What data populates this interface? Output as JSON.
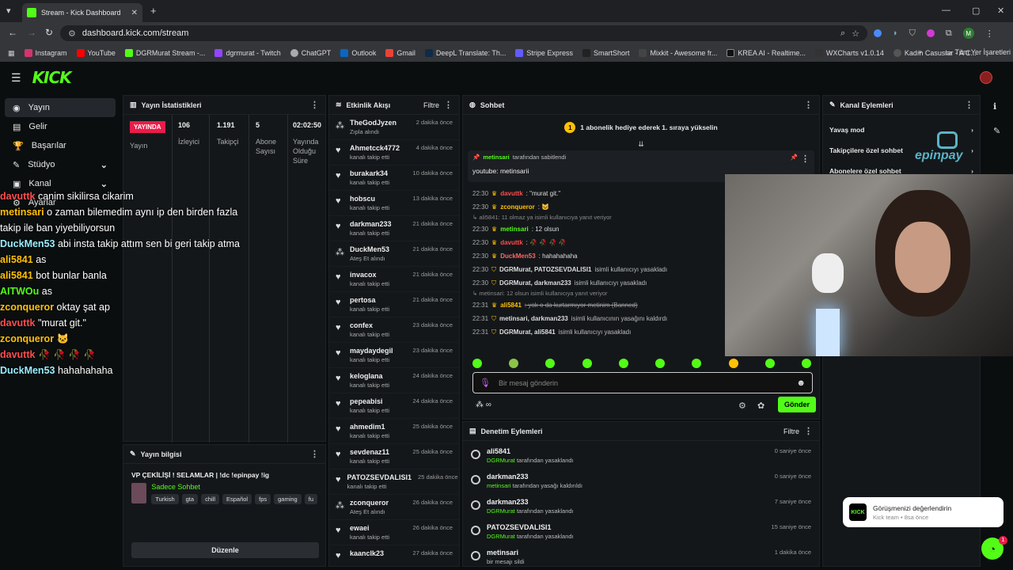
{
  "browser": {
    "tab_title": "Stream - Kick Dashboard",
    "url": "dashboard.kick.com/stream",
    "bookmarks": [
      "Instagram",
      "YouTube",
      "DGRMurat Stream -...",
      "dgrmurat - Twitch",
      "ChatGPT",
      "Outlook",
      "Gmail",
      "DeepL Translate: Th...",
      "Stripe Express",
      "SmartShort",
      "Mixkit - Awesome fr...",
      "KREA AI - Realtime...",
      "WXCharts v1.0.14",
      "Kadın Casuslar - A C..."
    ],
    "bookmarks_all": "Tüm Yer İşaretleri"
  },
  "nav": {
    "items": [
      {
        "label": "Yayın"
      },
      {
        "label": "Gelir"
      },
      {
        "label": "Başarılar"
      },
      {
        "label": "Stüdyo"
      },
      {
        "label": "Kanal"
      },
      {
        "label": "Ayarlar"
      }
    ]
  },
  "stats": {
    "title": "Yayın İstatistikleri",
    "live_badge": "YAYINDA",
    "live_label": "Yayın",
    "viewers": "106",
    "viewers_label": "İzleyici",
    "followers": "1.191",
    "followers_label": "Takipçi",
    "subs": "5",
    "subs_label": "Abone Sayısı",
    "uptime": "02:02:50",
    "uptime_label": "Yayında Olduğu Süre"
  },
  "overlay": [
    {
      "user": "davuttk",
      "color": "#ff4d4d",
      "msg": "canim sikilirsa cikarim"
    },
    {
      "user": "metinsari",
      "color": "#ffc107",
      "msg": "o zaman bilemedim aynı ip den birden fazla"
    },
    {
      "user": "",
      "color": "#fff",
      "msg": "takip ile ban yiyebiliyorsun"
    },
    {
      "user": "DuckMen53",
      "color": "#9ef",
      "msg": "abi insta takip attım sen bi geri takip atma"
    },
    {
      "user": "ali5841",
      "color": "#ffc107",
      "msg": "as"
    },
    {
      "user": "ali5841",
      "color": "#ffc107",
      "msg": "bot bunlar banla"
    },
    {
      "user": "AITWOu",
      "color": "#53fc18",
      "msg": "as"
    },
    {
      "user": "zconqueror",
      "color": "#ffc107",
      "msg": "oktay şat ap"
    },
    {
      "user": "davuttk",
      "color": "#ff4d4d",
      "msg": "\"murat git.\""
    },
    {
      "user": "zconqueror",
      "color": "#ffc107",
      "msg": "🐱"
    },
    {
      "user": "davuttk",
      "color": "#ff4d4d",
      "msg": "🥀 🥀 🥀 🥀"
    },
    {
      "user": "DuckMen53",
      "color": "#9ef",
      "msg": "hahahahaha"
    }
  ],
  "stream_info": {
    "title": "Yayın bilgisi",
    "stream_title": "VP ÇEKİLİŞİ ! SELAMLAR | !dc !epinpay !ig",
    "category": "Sadece Sohbet",
    "tags": [
      "Turkish",
      "gta",
      "chill",
      "Español",
      "fps",
      "gaming",
      "fu"
    ],
    "edit": "Düzenle"
  },
  "activity": {
    "title": "Etkinlik Akışı",
    "filter": "Filtre",
    "items": [
      {
        "name": "TheGodJyzen",
        "desc": "Zıpla alındı",
        "green": true,
        "time": "2 dakika önce"
      },
      {
        "name": "Ahmetcck4772",
        "desc": "kanalı takip etti",
        "time": "4 dakika önce"
      },
      {
        "name": "burakark34",
        "desc": "kanalı takip etti",
        "time": "10 dakika önce"
      },
      {
        "name": "hobscu",
        "desc": "kanalı takip etti",
        "time": "13 dakika önce"
      },
      {
        "name": "darkman233",
        "desc": "kanalı takip etti",
        "time": "21 dakika önce"
      },
      {
        "name": "DuckMen53",
        "desc": "Ateş Et alındı",
        "green": true,
        "time": "21 dakika önce"
      },
      {
        "name": "invacox",
        "desc": "kanalı takip etti",
        "time": "21 dakika önce"
      },
      {
        "name": "pertosa",
        "desc": "kanalı takip etti",
        "time": "21 dakika önce"
      },
      {
        "name": "confex",
        "desc": "kanalı takip etti",
        "time": "23 dakika önce"
      },
      {
        "name": "maydaydegil",
        "desc": "kanalı takip etti",
        "time": "23 dakika önce"
      },
      {
        "name": "keloglana",
        "desc": "kanalı takip etti",
        "time": "24 dakika önce"
      },
      {
        "name": "pepeabisi",
        "desc": "kanalı takip etti",
        "time": "24 dakika önce"
      },
      {
        "name": "ahmedim1",
        "desc": "kanalı takip etti",
        "time": "25 dakika önce"
      },
      {
        "name": "sevdenaz11",
        "desc": "kanalı takip etti",
        "time": "25 dakika önce"
      },
      {
        "name": "PATOZSEVDALISI1",
        "desc": "kanalı takip etti",
        "time": "25 dakika önce"
      },
      {
        "name": "zconqueror",
        "desc": "Ateş Et alındı",
        "green": true,
        "time": "26 dakika önce"
      },
      {
        "name": "ewaei",
        "desc": "kanalı takip etti",
        "time": "26 dakika önce"
      },
      {
        "name": "kaanclk23",
        "desc": "",
        "time": "27 dakika önce"
      }
    ]
  },
  "chat": {
    "title": "Sohbet",
    "banner": "1 abonelik hediye ederek 1. sıraya yükselin",
    "pinned_by": "metinsari",
    "pinned_suffix": "tarafından sabitlendi",
    "pinned_text": "youtube: metinsarii",
    "placeholder": "Bir mesaj gönderin",
    "send": "Gönder",
    "messages": [
      {
        "time": "22:30",
        "user": "davuttk",
        "color": "#ff4d4d",
        "text": ": \"murat git.\""
      },
      {
        "time": "22:30",
        "user": "zconqueror",
        "color": "#ffc107",
        "text": ": 🐱"
      },
      {
        "reply": "↳ ali5841: 11 olmaz ya isimli kullanıcıya yanıt veriyor"
      },
      {
        "time": "22:30",
        "user": "metinsari",
        "color": "#53fc18",
        "text": ": 12 olsun"
      },
      {
        "time": "22:30",
        "user": "davuttk",
        "color": "#ff4d4d",
        "text": ": 🥀 🥀 🥀 🥀"
      },
      {
        "time": "22:30",
        "user": "DuckMen53",
        "color": "#ff6666",
        "text": ": hahahahaha"
      },
      {
        "time": "22:30",
        "user": "DGRMurat, PATOZSEVDALISI1",
        "color": "#ddd",
        "text": "isimli kullanıcıyı yasakladı",
        "sys": true
      },
      {
        "time": "22:30",
        "user": "DGRMurat, darkman233",
        "color": "#ddd",
        "text": "isimli kullanıcıyı yasakladı",
        "sys": true
      },
      {
        "reply": "↳ metinsari: 12 olsun isimli kullanıcıya yanıt veriyor"
      },
      {
        "time": "22:31",
        "user": "ali5841",
        "color": "#ffc107",
        "text": ": yok o da kurtarmıyor metinim (Banned)",
        "strike": true
      },
      {
        "time": "22:31",
        "user": "metinsari, darkman233",
        "color": "#ddd",
        "text": "isimli kullanıcının yasağını kaldırdı",
        "sys": true
      },
      {
        "time": "22:31",
        "user": "DGRMurat, ali5841",
        "color": "#ddd",
        "text": "isimli kullanıcıyı yasakladı",
        "sys": true
      }
    ]
  },
  "moderation": {
    "title": "Denetim Eylemleri",
    "filter": "Filtre",
    "items": [
      {
        "name": "ali5841",
        "by": "DGRMurat",
        "desc": "tarafından yasaklandı",
        "time": "0 saniye önce"
      },
      {
        "name": "darkman233",
        "by": "metinsari",
        "desc": "tarafından yasağı kaldırıldı",
        "time": "0 saniye önce"
      },
      {
        "name": "darkman233",
        "by": "DGRMurat",
        "desc": "tarafından yasaklandı",
        "time": "7 saniye önce"
      },
      {
        "name": "PATOZSEVDALISI1",
        "by": "DGRMurat",
        "desc": "tarafından yasaklandı",
        "time": "15 saniye önce"
      },
      {
        "name": "metinsari",
        "by": "",
        "desc": "bir mesajı sildi",
        "time": "1 dakika önce"
      }
    ]
  },
  "channel": {
    "title": "Kanal Eylemleri",
    "items": [
      "Yavaş mod",
      "Takipçilere özel sohbet",
      "Abonelere özel sohbet"
    ]
  },
  "toast": {
    "title": "Görüşmenizi değerlendirin",
    "sub": "Kick team • 8sa önce",
    "badge": "1"
  },
  "colors": {
    "accent": "#53fc18",
    "live": "#e91c4a",
    "gold": "#ffc107"
  }
}
